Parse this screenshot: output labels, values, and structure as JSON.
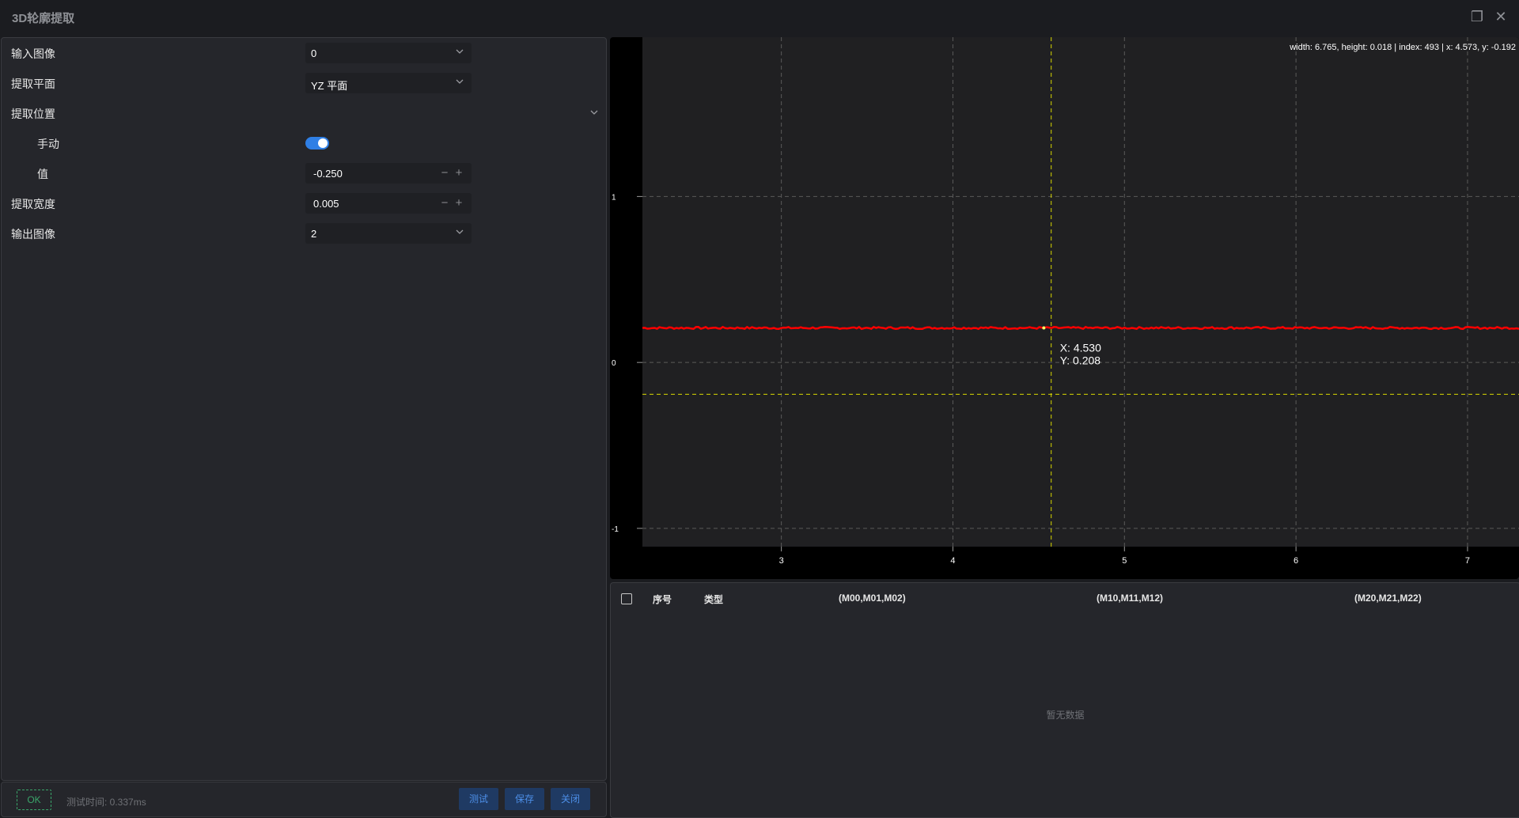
{
  "window": {
    "title": "3D轮廓提取"
  },
  "params": {
    "input_image": {
      "label": "输入图像",
      "value": "0"
    },
    "extract_plane": {
      "label": "提取平面",
      "value": "YZ 平面"
    },
    "extract_position": {
      "label": "提取位置"
    },
    "manual": {
      "label": "手动",
      "on": true
    },
    "value": {
      "label": "值",
      "value": "-0.250"
    },
    "extract_width": {
      "label": "提取宽度",
      "value": "0.005"
    },
    "output_image": {
      "label": "输出图像",
      "value": "2"
    }
  },
  "footer": {
    "status": "OK",
    "test_time": "测试时间: 0.337ms",
    "test_label": "测试",
    "save_label": "保存",
    "close_label": "关闭"
  },
  "chart_data": {
    "type": "line",
    "info": "width: 6.765, height: 0.018 | index: 493 | x: 4.573, y: -0.192",
    "x_ticks": [
      "3",
      "4",
      "5",
      "6",
      "7"
    ],
    "y_ticks": [
      "1",
      "0",
      "-1"
    ],
    "xlim": [
      2.19,
      7.3
    ],
    "ylim": [
      -1.11,
      1.96
    ],
    "grid": true,
    "series": [
      {
        "color": "#ff0000",
        "y_value": 0.208
      }
    ],
    "cursor": {
      "x": 4.573,
      "y": -0.192,
      "color": "#d8d800"
    },
    "marker": {
      "x": 4.53,
      "y": 0.208,
      "label_x": "X: 4.530",
      "label_y": "Y: 0.208"
    }
  },
  "table": {
    "columns": [
      "序号",
      "类型",
      "(M00,M01,M02)",
      "(M10,M11,M12)",
      "(M20,M21,M22)"
    ],
    "empty_text": "暂无数据"
  }
}
